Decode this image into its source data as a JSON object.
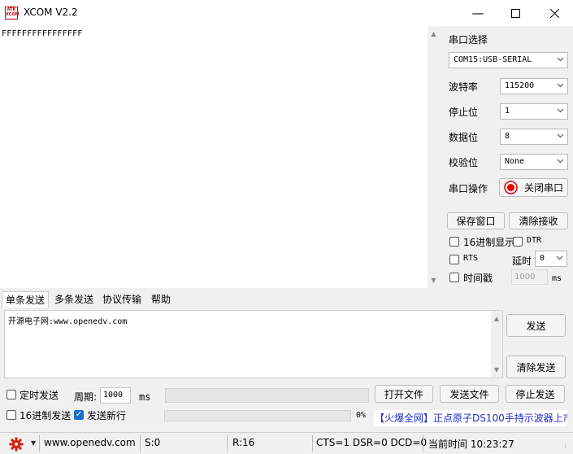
{
  "window": {
    "title": "XCOM V2.2",
    "logo_text": "ATK XCOM",
    "minimize_icon": "minimize-icon",
    "maximize_icon": "maximize-icon",
    "close_icon": "close-icon"
  },
  "receive": {
    "text": "FFFFFFFFFFFFFFFF"
  },
  "serial": {
    "port_label": "串口选择",
    "port_value": "COM15:USB-SERIAL",
    "baud_label": "波特率",
    "baud_value": "115200",
    "stopbits_label": "停止位",
    "stopbits_value": "1",
    "databits_label": "数据位",
    "databits_value": "8",
    "parity_label": "校验位",
    "parity_value": "None",
    "operation_label": "串口操作",
    "toggle_button": "关闭串口",
    "save_window": "保存窗口",
    "clear_receive": "清除接收",
    "hex_display": "16进制显示",
    "dtr": "DTR",
    "rts": "RTS",
    "delay_label": "延时",
    "delay_value": "0",
    "timestamp": "时间戳",
    "timestamp_value": "1000",
    "timestamp_unit": "ms"
  },
  "tabs": [
    "单条发送",
    "多条发送",
    "协议传输",
    "帮助"
  ],
  "send": {
    "text": "开源电子网:www.openedv.com",
    "send_button": "发送",
    "clear_send": "清除发送",
    "timed_send": "定时发送",
    "period_label": "周期:",
    "period_value": "1000",
    "period_unit": "ms",
    "open_file": "打开文件",
    "send_file": "发送文件",
    "stop_send": "停止发送",
    "hex_send": "16进制发送",
    "send_newline": "发送新行",
    "progress": "0%",
    "promo": "【火爆全网】正点原子DS100手持示波器上市"
  },
  "status": {
    "gear_icon": "gear-icon",
    "website": "www.openedv.com",
    "sent": "S:0",
    "received": "R:16",
    "lines": "CTS=1 DSR=0 DCD=0",
    "time_label": "当前时间 10:23:27"
  }
}
